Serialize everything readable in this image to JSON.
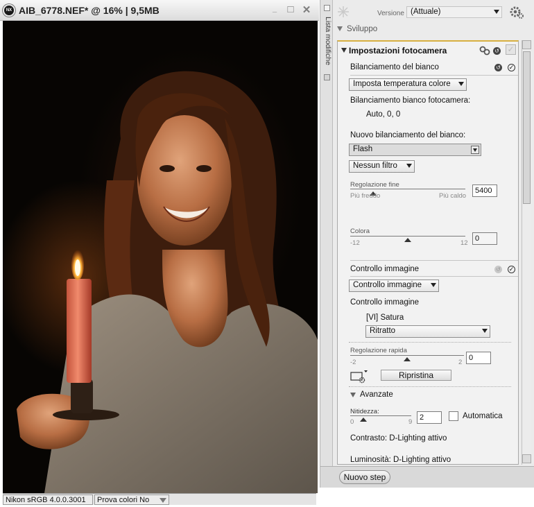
{
  "image_window": {
    "title": "AIB_6778.NEF* @ 16% | 9,5MB",
    "logo": "NX",
    "minimize_glyph": "_",
    "maximize_glyph": "□",
    "close_glyph": "✕",
    "status": {
      "profile": "Nikon sRGB 4.0.0.3001",
      "proof": "Prova colori No"
    }
  },
  "panel": {
    "vertical_tab_label": "Lista modifiche",
    "version_label": "Versione",
    "version_value": "(Attuale)",
    "development_label": "Sviluppo",
    "camera_settings": {
      "title": "Impostazioni fotocamera",
      "white_balance": {
        "title": "Bilanciamento del bianco",
        "mode_value": "Imposta temperatura colore",
        "camera_wb_label": "Bilanciamento bianco fotocamera:",
        "camera_wb_value": "Auto, 0, 0",
        "new_wb_label": "Nuovo bilanciamento del bianco:",
        "new_wb_value": "Flash",
        "filter_value": "Nessun filtro",
        "fine_tune_label": "Regolazione fine",
        "fine_tune_min": "Più freddo",
        "fine_tune_max": "Più caldo",
        "fine_tune_value": "5400",
        "fine_tune_pos": 0.2,
        "tint_label": "Colora",
        "tint_min": "-12",
        "tint_max": "12",
        "tint_value": "0",
        "tint_pos": 0.5
      },
      "picture_control": {
        "title": "Controllo immagine",
        "mode_value": "Controllo immagine",
        "label": "Controllo immagine",
        "current": "[VI] Satura",
        "preset_value": "Ritratto",
        "quick_adjust_label": "Regolazione rapida",
        "quick_min": "-2",
        "quick_max": "2",
        "quick_value": "0",
        "quick_pos": 0.5,
        "reset_label": "Ripristina",
        "advanced_label": "Avanzate",
        "sharpness_label": "Nitidezza:",
        "sharpness_min": "0",
        "sharpness_max": "9",
        "sharpness_value": "2",
        "sharpness_pos": 0.22,
        "auto_label": "Automatica",
        "contrast_label": "Contrasto: D-Lighting attivo",
        "brightness_label": "Luminosità: D-Lighting attivo"
      }
    },
    "new_step_label": "Nuovo step"
  }
}
